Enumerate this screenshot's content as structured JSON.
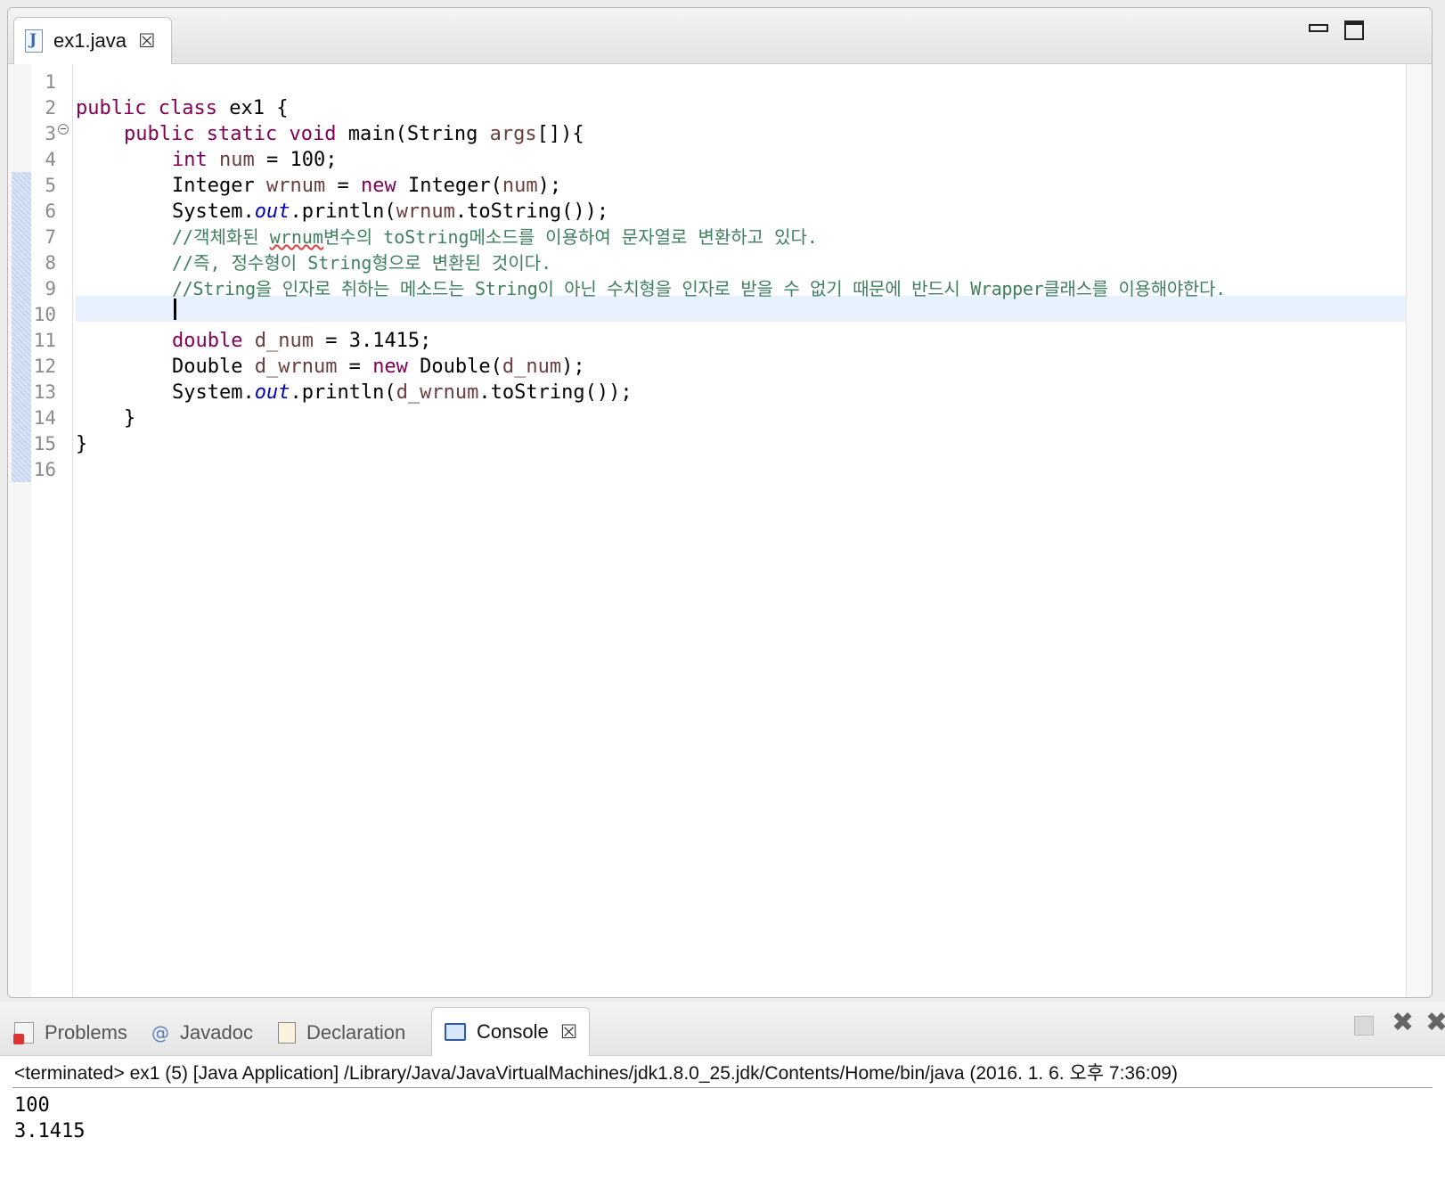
{
  "editor": {
    "tab_label": "ex1.java",
    "line_numbers": [
      "1",
      "2",
      "3",
      "4",
      "5",
      "6",
      "7",
      "8",
      "9",
      "10",
      "11",
      "12",
      "13",
      "14",
      "15",
      "16"
    ]
  },
  "code": {
    "l2_kw1": "public",
    "l2_kw2": "class",
    "l2_rest": " ex1 {",
    "l3_kw1": "public",
    "l3_kw2": "static",
    "l3_kw3": "void",
    "l3_a": " main(String ",
    "l3_var": "args",
    "l3_b": "[]){",
    "l4_kw": "int",
    "l4_var": "num",
    "l4_rest": " = 100;",
    "l5_a": "Integer ",
    "l5_var": "wrnum",
    "l5_b": " = ",
    "l5_kw": "new",
    "l5_c": " Integer(",
    "l5_var2": "num",
    "l5_d": ");",
    "l6_a": "System.",
    "l6_field": "out",
    "l6_b": ".println(",
    "l6_var": "wrnum",
    "l6_c": ".toString());",
    "l7_a": "//객체화된 ",
    "l7_sq": "wrnum",
    "l7_b": "변수의 toString메소드를 이용하여 문자열로 변환하고 있다.",
    "l8": "//즉, 정수형이 String형으로 변환된 것이다.",
    "l9": "//String을 인자로 취하는 메소드는 String이 아닌 수치형을 인자로 받을 수 없기 때문에 반드시 Wrapper클래스를 이용해야한다.",
    "l11_kw": "double",
    "l11_var": "d_num",
    "l11_rest": " = 3.1415;",
    "l12_a": "Double ",
    "l12_var": "d_wrnum",
    "l12_b": " = ",
    "l12_kw": "new",
    "l12_c": " Double(",
    "l12_var2": "d_num",
    "l12_d": ");",
    "l13_a": "System.",
    "l13_field": "out",
    "l13_b": ".println(",
    "l13_var": "d_wrnum",
    "l13_c": ".toString());",
    "l14": "}",
    "l15": "}"
  },
  "console": {
    "tabs": [
      "Problems",
      "Javadoc",
      "Declaration",
      "Console"
    ],
    "javadoc_icon": "@",
    "terminated": "<terminated> ex1 (5) [Java Application] /Library/Java/JavaVirtualMachines/jdk1.8.0_25.jdk/Contents/Home/bin/java (2016. 1. 6. 오후 7:36:09)",
    "output": [
      "100",
      "3.1415"
    ]
  },
  "icons": {
    "close": "⮽",
    "remove": "✖",
    "remove_all": "✖"
  }
}
